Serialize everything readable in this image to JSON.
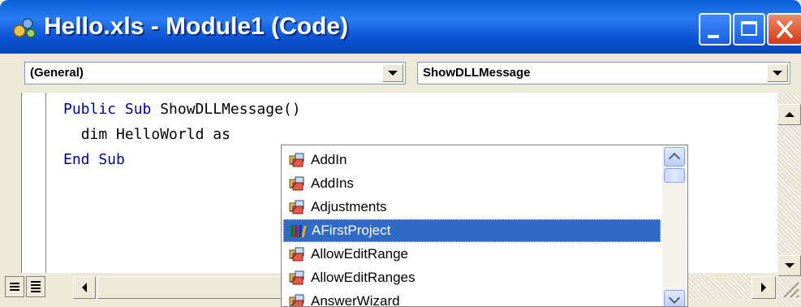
{
  "window": {
    "title": "Hello.xls - Module1 (Code)",
    "icon": "vba-code-module-icon",
    "controls": [
      "minimize-icon",
      "maximize-icon",
      "close-icon"
    ]
  },
  "combos": {
    "object": {
      "value": "(General)"
    },
    "procedure": {
      "value": "ShowDLLMessage"
    }
  },
  "code": {
    "lines": [
      {
        "keyword": "Public Sub",
        "rest": " ShowDLLMessage()"
      },
      {
        "indent": "  ",
        "text": "dim HelloWorld as"
      },
      {
        "keyword": "End Sub",
        "rest": ""
      }
    ]
  },
  "autocomplete": {
    "items": [
      {
        "label": "AddIn",
        "icon": "class-icon",
        "selected": false
      },
      {
        "label": "AddIns",
        "icon": "class-icon",
        "selected": false
      },
      {
        "label": "Adjustments",
        "icon": "class-icon",
        "selected": false
      },
      {
        "label": "AFirstProject",
        "icon": "library-icon",
        "selected": true
      },
      {
        "label": "AllowEditRange",
        "icon": "class-icon",
        "selected": false
      },
      {
        "label": "AllowEditRanges",
        "icon": "class-icon",
        "selected": false
      },
      {
        "label": "AnswerWizard",
        "icon": "class-icon",
        "selected": false
      }
    ]
  },
  "colors": {
    "titlebar": "#0b54d4",
    "keyword": "#00008b",
    "selection": "#316ac5"
  }
}
